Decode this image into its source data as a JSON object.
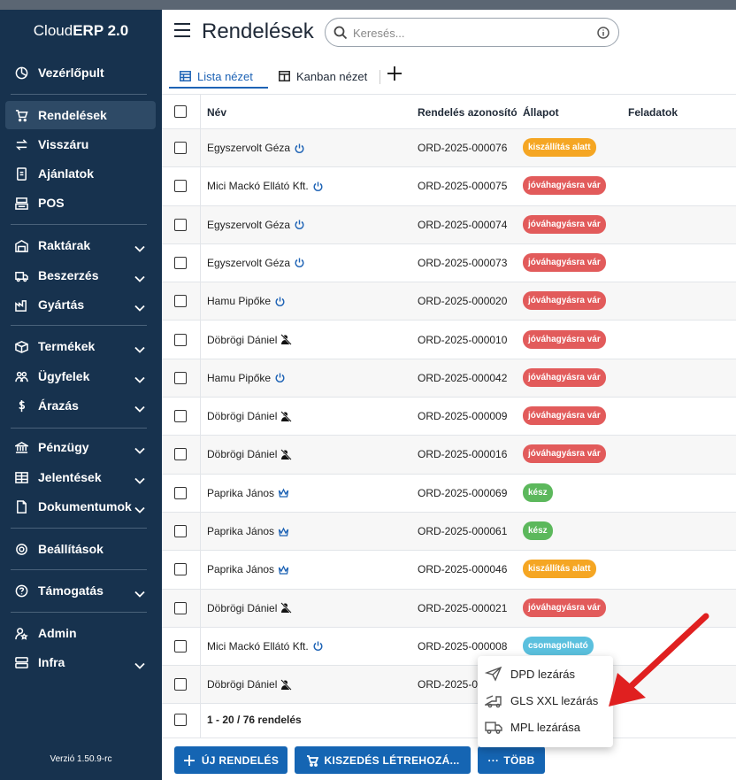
{
  "app": {
    "brand_prefix": "Cloud",
    "brand_bold": "ERP 2.0",
    "version": "Verzió 1.50.9-rc"
  },
  "sidebar": {
    "items": [
      {
        "label": "Vezérlőpult",
        "icon": "dashboard-icon"
      },
      {
        "label": "Rendelések",
        "icon": "cart-icon",
        "active": true
      },
      {
        "label": "Visszáru",
        "icon": "swap-icon"
      },
      {
        "label": "Ajánlatok",
        "icon": "offer-icon"
      },
      {
        "label": "POS",
        "icon": "pos-icon"
      },
      {
        "label": "Raktárak",
        "icon": "warehouse-icon",
        "expandable": true
      },
      {
        "label": "Beszerzés",
        "icon": "truck-icon",
        "expandable": true
      },
      {
        "label": "Gyártás",
        "icon": "factory-icon",
        "expandable": true
      },
      {
        "label": "Termékek",
        "icon": "box-icon",
        "expandable": true
      },
      {
        "label": "Ügyfelek",
        "icon": "users-icon",
        "expandable": true
      },
      {
        "label": "Árazás",
        "icon": "dollar-icon",
        "expandable": true
      },
      {
        "label": "Pénzügy",
        "icon": "bank-icon",
        "expandable": true
      },
      {
        "label": "Jelentések",
        "icon": "table-icon",
        "expandable": true
      },
      {
        "label": "Dokumentumok",
        "icon": "document-icon",
        "expandable": true
      },
      {
        "label": "Beállítások",
        "icon": "gear-icon"
      },
      {
        "label": "Támogatás",
        "icon": "help-icon",
        "expandable": true
      },
      {
        "label": "Admin",
        "icon": "admin-icon"
      },
      {
        "label": "Infra",
        "icon": "server-icon",
        "expandable": true
      }
    ]
  },
  "header": {
    "title": "Rendelések",
    "search_placeholder": "Keresés..."
  },
  "tabs": [
    {
      "label": "Lista nézet",
      "active": true
    },
    {
      "label": "Kanban nézet"
    }
  ],
  "table": {
    "columns": [
      "Név",
      "Rendelés azonosító",
      "Állapot",
      "Feladatok"
    ],
    "rows": [
      {
        "name": "Egyszervolt Géza",
        "marker": "power",
        "order": "ORD-2025-000076",
        "status": "kiszállítás alatt",
        "status_color": "#f5a623"
      },
      {
        "name": "Mici Mackó Ellátó Kft.",
        "marker": "power",
        "order": "ORD-2025-000075",
        "status": "jóváhagyásra vár",
        "status_color": "#e25b5b"
      },
      {
        "name": "Egyszervolt Géza",
        "marker": "power",
        "order": "ORD-2025-000074",
        "status": "jóváhagyásra vár",
        "status_color": "#e25b5b"
      },
      {
        "name": "Egyszervolt Géza",
        "marker": "power",
        "order": "ORD-2025-000073",
        "status": "jóváhagyásra vár",
        "status_color": "#e25b5b"
      },
      {
        "name": "Hamu Pipőke",
        "marker": "power",
        "order": "ORD-2025-000020",
        "status": "jóváhagyásra vár",
        "status_color": "#e25b5b"
      },
      {
        "name": "Döbrögi Dániel",
        "marker": "blocked",
        "order": "ORD-2025-000010",
        "status": "jóváhagyásra vár",
        "status_color": "#e25b5b"
      },
      {
        "name": "Hamu Pipőke",
        "marker": "power",
        "order": "ORD-2025-000042",
        "status": "jóváhagyásra vár",
        "status_color": "#e25b5b"
      },
      {
        "name": "Döbrögi Dániel",
        "marker": "blocked",
        "order": "ORD-2025-000009",
        "status": "jóváhagyásra vár",
        "status_color": "#e25b5b"
      },
      {
        "name": "Döbrögi Dániel",
        "marker": "blocked",
        "order": "ORD-2025-000016",
        "status": "jóváhagyásra vár",
        "status_color": "#e25b5b"
      },
      {
        "name": "Paprika János",
        "marker": "crown",
        "order": "ORD-2025-000069",
        "status": "kész",
        "status_color": "#5cb85c"
      },
      {
        "name": "Paprika János",
        "marker": "crown",
        "order": "ORD-2025-000061",
        "status": "kész",
        "status_color": "#5cb85c"
      },
      {
        "name": "Paprika János",
        "marker": "crown",
        "order": "ORD-2025-000046",
        "status": "kiszállítás alatt",
        "status_color": "#f5a623"
      },
      {
        "name": "Döbrögi Dániel",
        "marker": "blocked",
        "order": "ORD-2025-000021",
        "status": "jóváhagyásra vár",
        "status_color": "#e25b5b"
      },
      {
        "name": "Mici Mackó Ellátó Kft.",
        "marker": "power",
        "order": "ORD-2025-000008",
        "status": "csomagolható",
        "status_color": "#5bc0de"
      },
      {
        "name": "Döbrögi Dániel",
        "marker": "blocked",
        "order": "ORD-2025-00",
        "status": "",
        "status_color": ""
      }
    ],
    "footer_count": "1 - 20 / 76 rendelés"
  },
  "actions": {
    "new_order": "ÚJ RENDELÉS",
    "picking": "KISZEDÉS LÉTREHOZÁ...",
    "more": "TÖBB"
  },
  "more_menu": [
    {
      "label": "DPD lezárás",
      "icon": "send-icon"
    },
    {
      "label": "GLS XXL lezárás",
      "icon": "truck-ramp-icon"
    },
    {
      "label": "MPL lezárása",
      "icon": "delivery-truck-icon"
    }
  ],
  "colors": {
    "sidebar_bg": "#17324e",
    "accent": "#1565b3",
    "arrow": "#e02020"
  }
}
